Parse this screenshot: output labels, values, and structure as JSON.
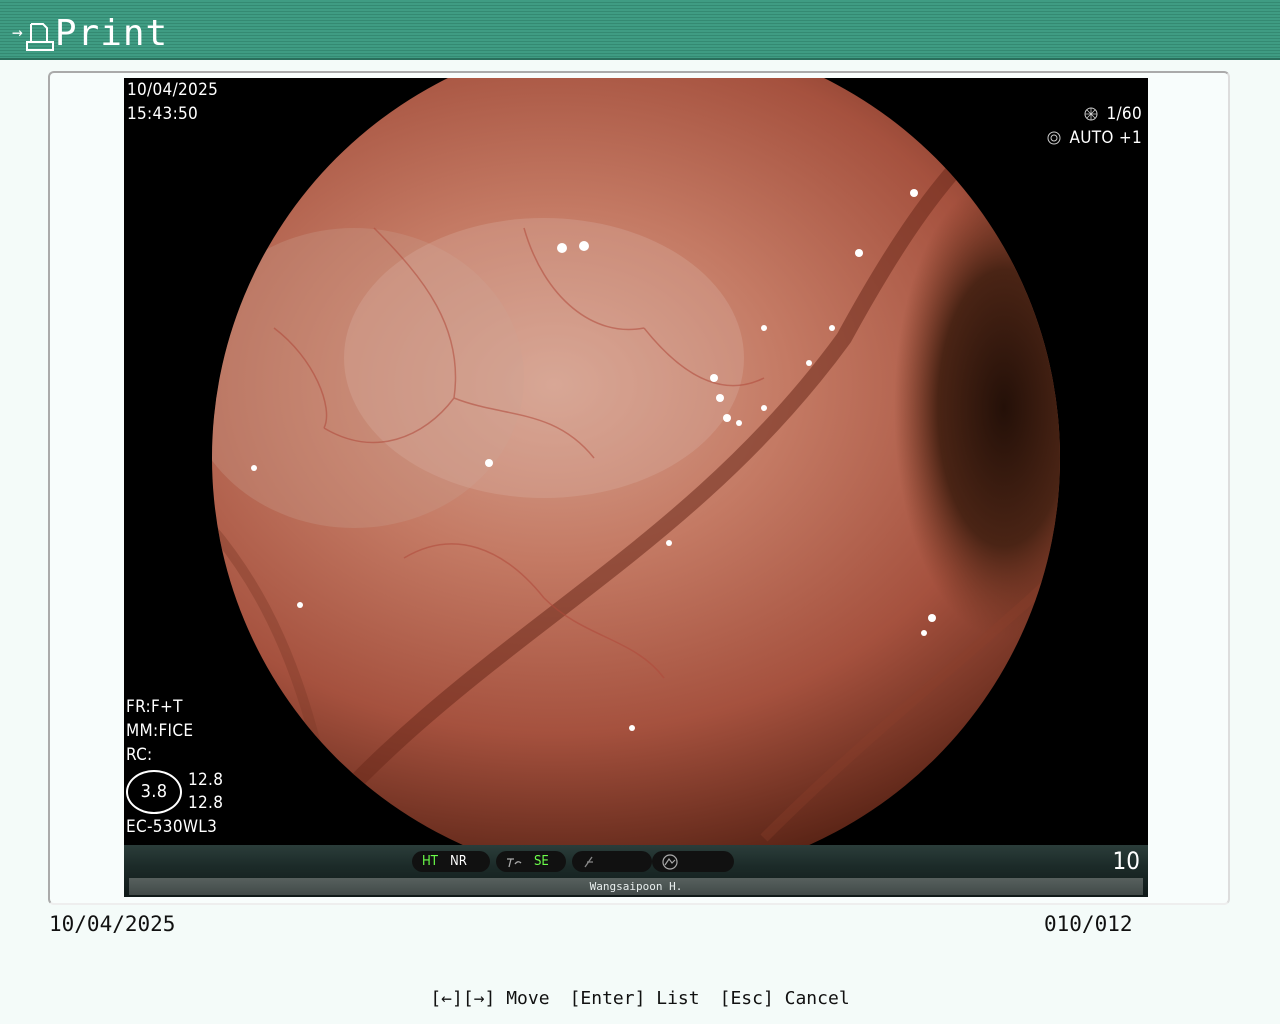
{
  "header": {
    "arrow": "→",
    "title": "Print",
    "icon": "print-icon"
  },
  "image": {
    "date": "10/04/2025",
    "time": "15:43:50",
    "shutter": "1/60",
    "iris": "AUTO +1",
    "fr": "FR:F+T",
    "mm": "MM:FICE",
    "rc": "RC:",
    "gauge_value": "3.8",
    "gauge_top": "12.8",
    "gauge_bottom": "12.8",
    "scope_model": "EC-530WL3",
    "status": {
      "ht": "HT",
      "nr": "NR",
      "se": "SE",
      "counter": "10"
    },
    "patient_name": "Wangsaipoon H."
  },
  "footer": {
    "date": "10/04/2025",
    "index": "010/012",
    "help_move": "[←][→] Move",
    "help_list": "[Enter] List",
    "help_cancel": "[Esc] Cancel"
  },
  "colors": {
    "header": "#3f9c83",
    "osd_green": "#6cff4a"
  }
}
